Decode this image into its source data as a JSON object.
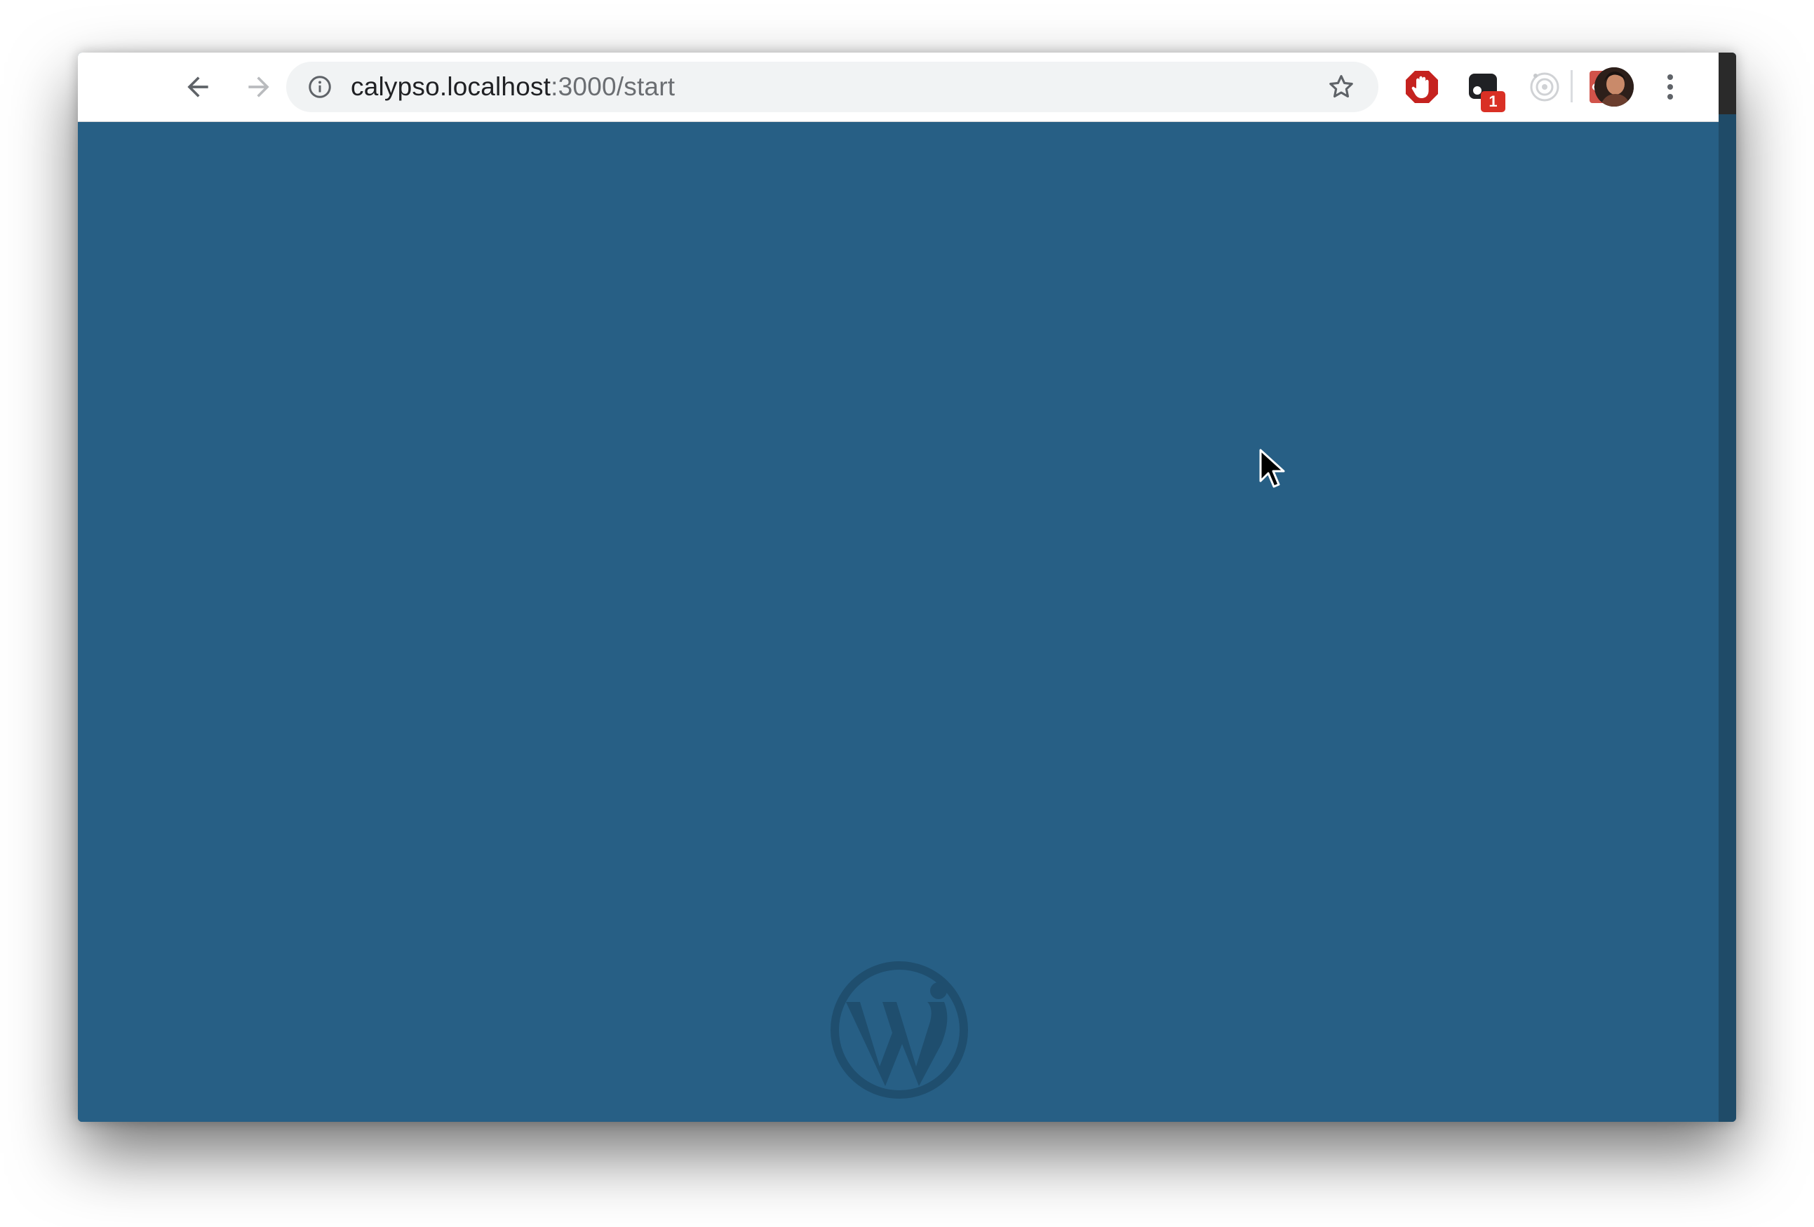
{
  "browser": {
    "url_host": "calypso.localhost",
    "url_path": ":3000/start",
    "extension_badge": "1"
  },
  "colors": {
    "page_background": "#275f85",
    "logo_color": "#1f4e6e",
    "badge_color": "#d93025"
  },
  "icons": {
    "back": "arrow-left-icon",
    "forward": "arrow-right-icon",
    "stop": "close-icon",
    "site_info": "info-icon",
    "bookmark": "star-icon",
    "extensions": [
      "stop-hand-icon",
      "chat-icon",
      "camera-lens-icon",
      "react-atom-icon"
    ],
    "profile": "avatar",
    "menu": "three-dots-vertical-icon",
    "logo": "wordpress-logo"
  }
}
